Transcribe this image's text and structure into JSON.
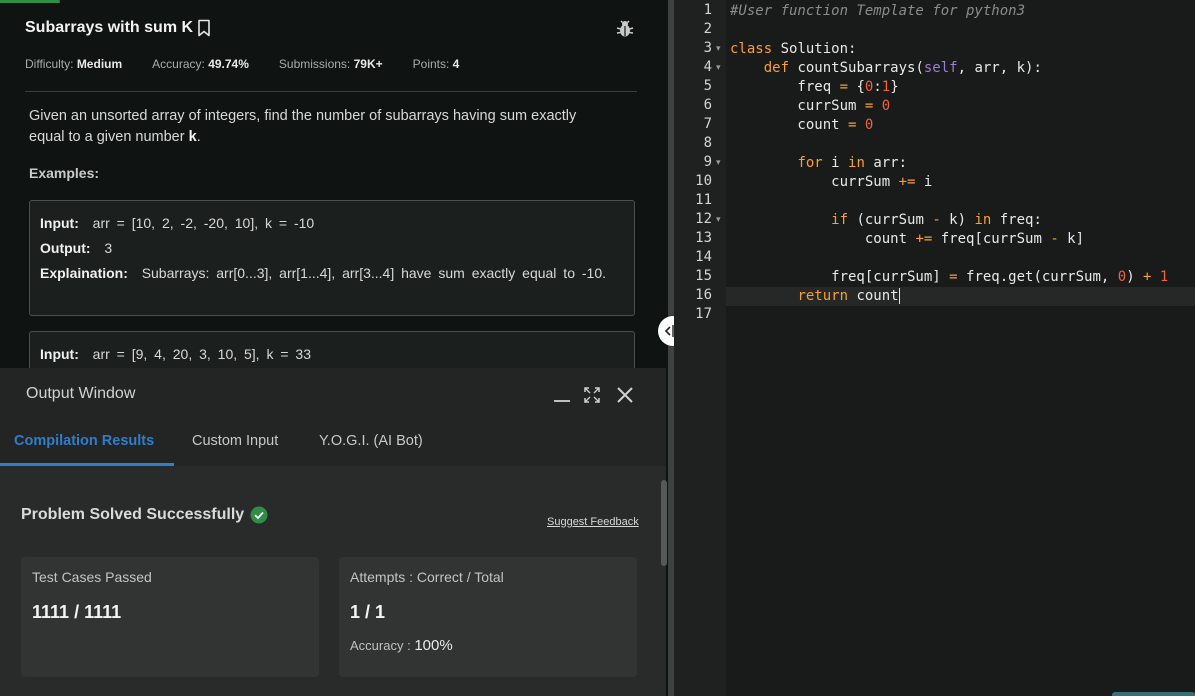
{
  "problem": {
    "title": "Subarrays with sum K",
    "meta": [
      {
        "label": "Difficulty:",
        "value": "Medium"
      },
      {
        "label": "Accuracy:",
        "value": "49.74%"
      },
      {
        "label": "Submissions:",
        "value": "79K+"
      },
      {
        "label": "Points:",
        "value": "4"
      }
    ],
    "description_pre": "Given an unsorted array of integers, find the number of subarrays having sum exactly equal to a given number ",
    "description_k": "k",
    "description_post": ".",
    "examples_title": "Examples:",
    "example1": {
      "input_label": "Input:",
      "input_value": "arr = [10, 2, -2, -20, 10], k = -10",
      "output_label": "Output:",
      "output_value": "3",
      "explanation_label": "Explaination:",
      "explanation_value": "Subarrays: arr[0...3], arr[1...4], arr[3...4] have sum exactly equal to -10."
    },
    "example2": {
      "input_label": "Input:",
      "input_value": "arr = [9, 4, 20, 3, 10, 5], k = 33"
    }
  },
  "output_window": {
    "title": "Output Window",
    "tabs": [
      "Compilation Results",
      "Custom Input",
      "Y.O.G.I. (AI Bot)"
    ],
    "active_tab": 0,
    "status": "Problem Solved Successfully",
    "suggest_feedback": "Suggest Feedback",
    "test_cases": {
      "label": "Test Cases Passed",
      "value": "1111 / 1111"
    },
    "attempts": {
      "label": "Attempts : Correct / Total",
      "value": "1 / 1",
      "accuracy_label": "Accuracy :",
      "accuracy_value": "100%"
    }
  },
  "editor": {
    "line_numbers": [
      "1",
      "2",
      "3",
      "4",
      "5",
      "6",
      "7",
      "8",
      "9",
      "10",
      "11",
      "12",
      "13",
      "14",
      "15",
      "16",
      "17"
    ],
    "fold_lines": [
      3,
      4,
      9,
      12
    ],
    "active_line": 16,
    "lines": [
      "#User function Template for python3",
      "",
      "class Solution:",
      "    def countSubarrays(self, arr, k):",
      "        freq = {0:1}",
      "        currSum = 0",
      "        count = 0",
      "",
      "        for i in arr:",
      "            currSum += i",
      "",
      "            if (currSum - k) in freq:",
      "                count += freq[currSum - k]",
      "",
      "            freq[currSum] = freq.get(currSum, 0) + 1",
      "        return count",
      ""
    ]
  },
  "colors": {
    "accent_green": "#2f8d46",
    "tab_blue": "#2e7ecb",
    "keyword": "#f9a12a",
    "number": "#f6603f",
    "comment": "#8a8c8b"
  }
}
